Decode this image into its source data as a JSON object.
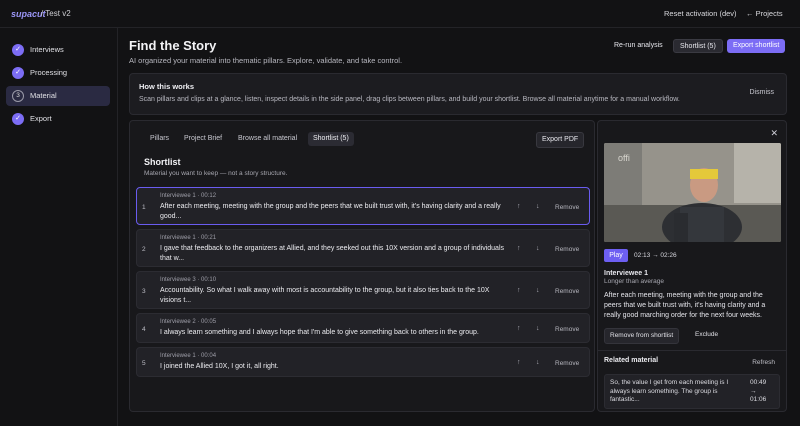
{
  "topbar": {
    "logo": "supacut",
    "project": "/ Test v2",
    "reset": "Reset activation (dev)",
    "projects": "← Projects"
  },
  "sidebar": {
    "steps": [
      {
        "label": "Interviews",
        "marker": "✓",
        "state": "done"
      },
      {
        "label": "Processing",
        "marker": "✓",
        "state": "done"
      },
      {
        "label": "Material",
        "marker": "3",
        "state": "active"
      },
      {
        "label": "Export",
        "marker": "✓",
        "state": "done"
      }
    ]
  },
  "header": {
    "title": "Find the Story",
    "subtitle": "AI organized your material into thematic pillars. Explore, validate, and take control.",
    "rerun": "Re-run analysis",
    "shortlist_count": "Shortlist (5)",
    "export_shortlist": "Export shortlist"
  },
  "how": {
    "title": "How this works",
    "text": "Scan pillars and clips at a glance, listen, inspect details in the side panel, drag clips between pillars, and build your shortlist. Browse all material anytime for a manual workflow.",
    "dismiss": "Dismiss"
  },
  "tabs": [
    {
      "label": "Pillars"
    },
    {
      "label": "Project Brief"
    },
    {
      "label": "Browse all material"
    },
    {
      "label": "Shortlist (5)"
    }
  ],
  "export_pdf": "Export PDF",
  "shortlist": {
    "title": "Shortlist",
    "subtitle": "Material you want to keep — not a story structure.",
    "remove_label": "Remove",
    "up": "↑",
    "down": "↓",
    "items": [
      {
        "index": "1",
        "meta": "Interviewee 1 · 00:12",
        "text": "After each meeting, meeting with the group and the peers that we built trust with, it's having clarity and a really good..."
      },
      {
        "index": "2",
        "meta": "Interviewee 1 · 00:21",
        "text": "I gave that feedback to the organizers at Allied, and they seeked out this 10X version and a group of individuals that w..."
      },
      {
        "index": "3",
        "meta": "Interviewee 3 · 00:10",
        "text": "Accountability. So what I walk away with most is accountability to the group, but it also ties back to the 10X visions t..."
      },
      {
        "index": "4",
        "meta": "Interviewee 2 · 00:05",
        "text": "I always learn something and I always hope that I'm able to give something back to others in the group."
      },
      {
        "index": "5",
        "meta": "Interviewee 1 · 00:04",
        "text": "I joined the Allied 10X, I got it, all right."
      }
    ]
  },
  "side": {
    "close": "✕",
    "play": "Play",
    "time": "02:13 → 02:26",
    "who": "Interviewee 1",
    "length": "Longer than average",
    "quote": "After each meeting, meeting with the group and the peers that we built trust with, it's having clarity and a really good marching order for the next four weeks.",
    "remove_shortlist": "Remove from shortlist",
    "exclude": "Exclude",
    "related_title": "Related material",
    "refresh": "Refresh",
    "related": {
      "text": "So, the value I get from each meeting is I always learn something. The group is fantastic...",
      "start": "00:49",
      "arrow": "→",
      "end": "01:06"
    },
    "video_sign": "offi"
  },
  "colors": {
    "accent": "#7c6df5",
    "background": "#121214",
    "panel": "#18181b"
  }
}
